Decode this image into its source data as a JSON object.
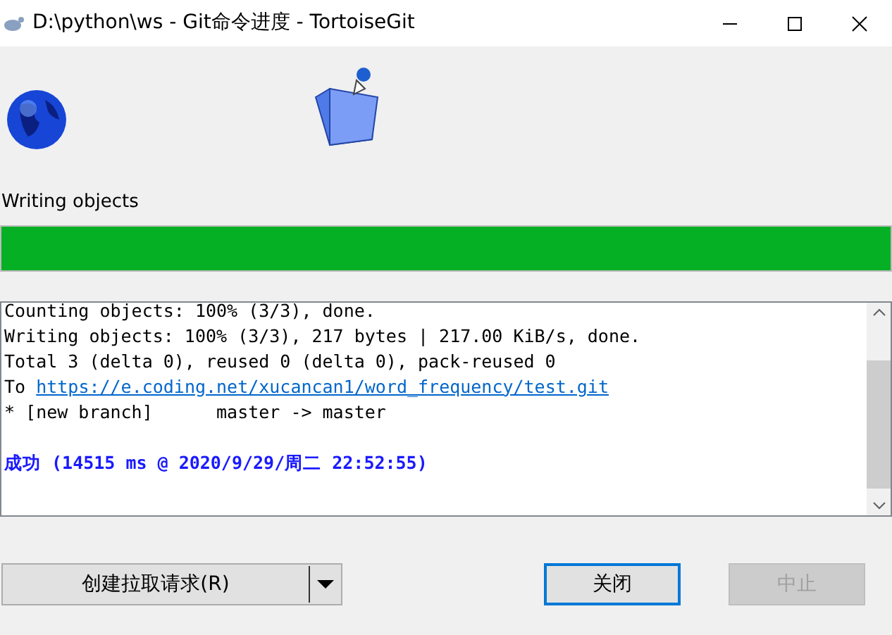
{
  "window": {
    "title": "D:\\python\\ws - Git命令进度 - TortoiseGit"
  },
  "status": {
    "label": "Writing objects"
  },
  "progress": {
    "level": 1
  },
  "log": [
    {
      "kind": "text",
      "text": "Counting objects: 100% (3/3), done."
    },
    {
      "kind": "text",
      "text": "Writing objects: 100% (3/3), 217 bytes | 217.00 KiB/s, done."
    },
    {
      "kind": "text",
      "text": "Total 3 (delta 0), reused 0 (delta 0), pack-reused 0"
    },
    {
      "kind": "link",
      "prefix": "To",
      "url": "https://e.coding.net/xucancan1/word_frequency/test.git"
    },
    {
      "kind": "text",
      "text": "* [new branch]      master -> master"
    },
    {
      "kind": "success",
      "text": "成功 (14515 ms @ 2020/9/29/周二 22:52:55)"
    }
  ],
  "buttons": [
    {
      "kind": "split",
      "label": "创建拉取请求(R)",
      "disabled": false
    },
    {
      "kind": "default",
      "label": "关闭",
      "disabled": false
    },
    {
      "kind": "plain",
      "label": "中止",
      "disabled": true
    }
  ]
}
